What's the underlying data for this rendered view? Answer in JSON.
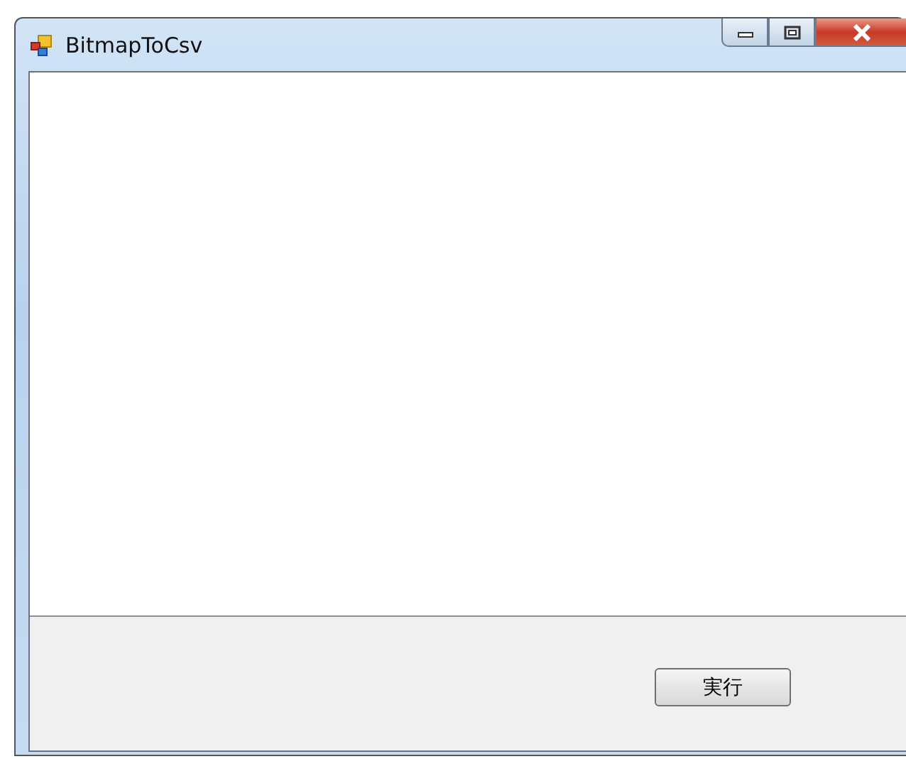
{
  "window": {
    "title": "BitmapToCsv"
  },
  "buttons": [
    {
      "label": "実行"
    }
  ]
}
